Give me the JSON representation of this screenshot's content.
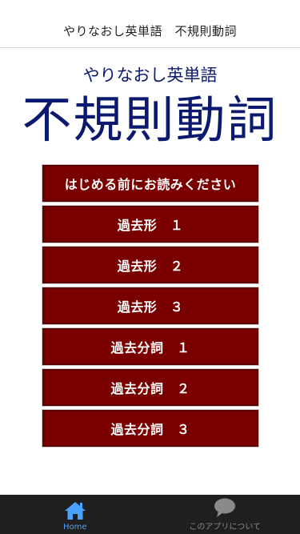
{
  "header": {
    "title": "やりなおし英単語　不規則動詞"
  },
  "hero": {
    "subtitle": "やりなおし英単語",
    "title": "不規則動詞"
  },
  "menu": {
    "items": [
      {
        "label": "はじめる前にお読みください"
      },
      {
        "label": "過去形　１"
      },
      {
        "label": "過去形　２"
      },
      {
        "label": "過去形　３"
      },
      {
        "label": "過去分詞　１"
      },
      {
        "label": "過去分詞　２"
      },
      {
        "label": "過去分詞　３"
      }
    ],
    "button_color": "#7a0000"
  },
  "tabbar": {
    "tabs": [
      {
        "label": "Home",
        "icon": "home-icon",
        "active": true
      },
      {
        "label": "このアプリについて",
        "icon": "speech-bubble-icon",
        "active": false
      }
    ],
    "active_color": "#4aa3ff",
    "inactive_color": "#8a8a8a"
  },
  "colors": {
    "title_navy": "#0b1a6e",
    "tabbar_bg": "#1f1f1f"
  }
}
